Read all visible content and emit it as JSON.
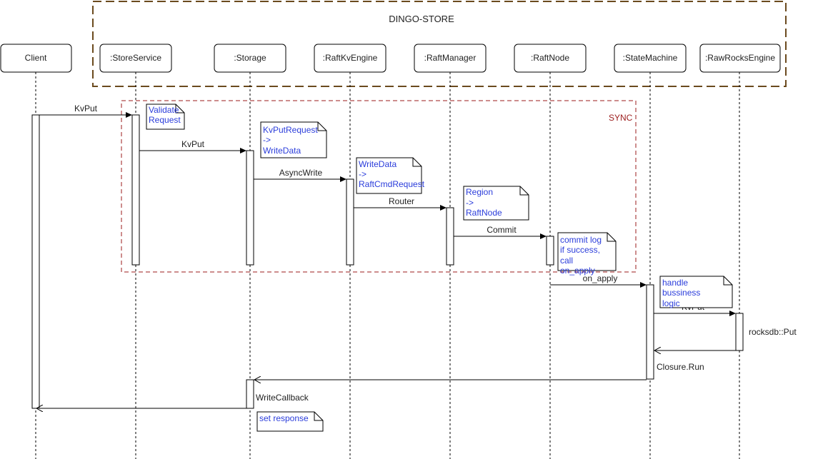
{
  "frame": {
    "title": "DINGO-STORE"
  },
  "sync_frame": {
    "label": "SYNC"
  },
  "participants": [
    {
      "id": "client",
      "label": "Client"
    },
    {
      "id": "store_service",
      "label": ":StoreService"
    },
    {
      "id": "storage",
      "label": ":Storage"
    },
    {
      "id": "raft_kv_engine",
      "label": ":RaftKvEngine"
    },
    {
      "id": "raft_manager",
      "label": ":RaftManager"
    },
    {
      "id": "raft_node",
      "label": ":RaftNode"
    },
    {
      "id": "state_machine",
      "label": ":StateMachine"
    },
    {
      "id": "raw_rocks_engine",
      "label": ":RawRocksEngine"
    }
  ],
  "messages": [
    {
      "id": "m1",
      "label": "KvPut"
    },
    {
      "id": "m2",
      "label": "KvPut"
    },
    {
      "id": "m3",
      "label": "AsyncWrite"
    },
    {
      "id": "m4",
      "label": "Router"
    },
    {
      "id": "m5",
      "label": "Commit"
    },
    {
      "id": "m6",
      "label": "on_apply"
    },
    {
      "id": "m7",
      "label": "KvPut"
    },
    {
      "id": "m8",
      "label": "rocksdb::Put"
    },
    {
      "id": "m9",
      "label": "Closure.Run"
    },
    {
      "id": "m10",
      "label": "WriteCallback"
    }
  ],
  "notes": [
    {
      "id": "n1",
      "lines": [
        "Validate",
        "Request"
      ]
    },
    {
      "id": "n2",
      "lines": [
        "KvPutRequest",
        "->",
        "WriteData"
      ]
    },
    {
      "id": "n3",
      "lines": [
        "WriteData",
        "->",
        "RaftCmdRequest"
      ]
    },
    {
      "id": "n4",
      "lines": [
        "Region",
        "->",
        "RaftNode"
      ]
    },
    {
      "id": "n5",
      "lines": [
        "commit log",
        "if success,",
        "call",
        "on_apply"
      ]
    },
    {
      "id": "n6",
      "lines": [
        "handle",
        "bussiness",
        "logic"
      ]
    },
    {
      "id": "n7",
      "lines": [
        "set response"
      ]
    }
  ],
  "colors": {
    "frame": "#6b4a1e",
    "sync": "#9b1b1b",
    "note_text": "#2b3ddb",
    "line": "#000000"
  }
}
